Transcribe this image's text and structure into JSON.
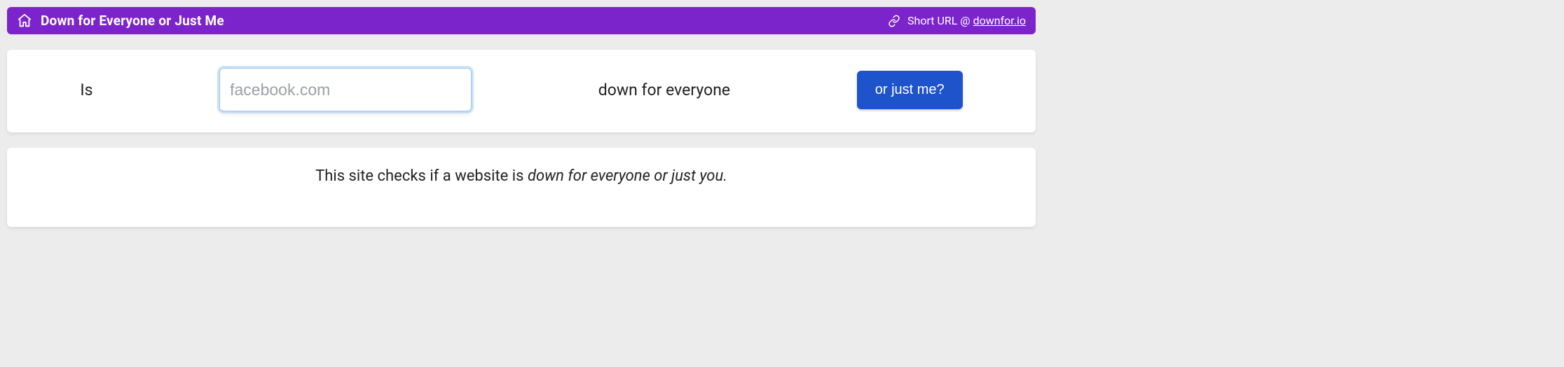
{
  "header": {
    "title": "Down for Everyone or Just Me",
    "short_url_label": "Short URL @ ",
    "short_url_link": "downfor.io"
  },
  "form": {
    "prefix": "Is",
    "placeholder": "facebook.com",
    "value": "",
    "middle": "down for everyone",
    "button": "or just me?"
  },
  "description": {
    "prefix": "This site checks if a website is ",
    "italic": "down for everyone or just you."
  }
}
